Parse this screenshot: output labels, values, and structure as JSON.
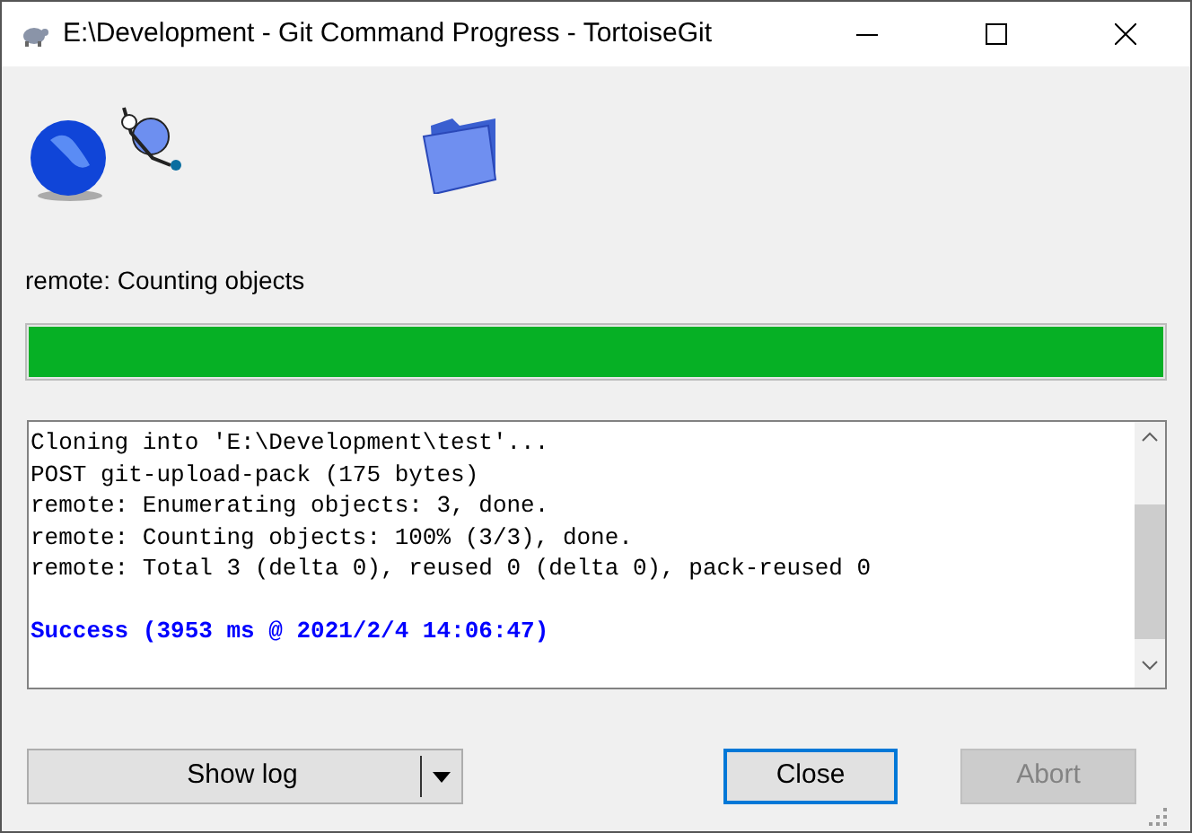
{
  "window": {
    "title": "E:\\Development - Git Command Progress - TortoiseGit"
  },
  "status_text": "remote: Counting objects",
  "progress": {
    "level": 1.0
  },
  "log": [
    {
      "kind": "normal",
      "text": "Cloning into 'E:\\Development\\test'..."
    },
    {
      "kind": "normal",
      "text": "POST git-upload-pack (175 bytes)"
    },
    {
      "kind": "normal",
      "text": "remote: Enumerating objects: 3, done."
    },
    {
      "kind": "normal",
      "text": "remote: Counting objects: 100% (3/3), done."
    },
    {
      "kind": "normal",
      "text": "remote: Total 3 (delta 0), reused 0 (delta 0), pack-reused 0"
    },
    {
      "kind": "success",
      "text": "Success (3953 ms @ 2021/2/4 14:06:47)"
    }
  ],
  "buttons": [
    {
      "kind": "split",
      "label": "Show log",
      "disabled": false,
      "focused": false
    },
    {
      "kind": "plain",
      "label": "Close",
      "disabled": false,
      "focused": true
    },
    {
      "kind": "plain",
      "label": "Abort",
      "disabled": true,
      "focused": false
    }
  ]
}
